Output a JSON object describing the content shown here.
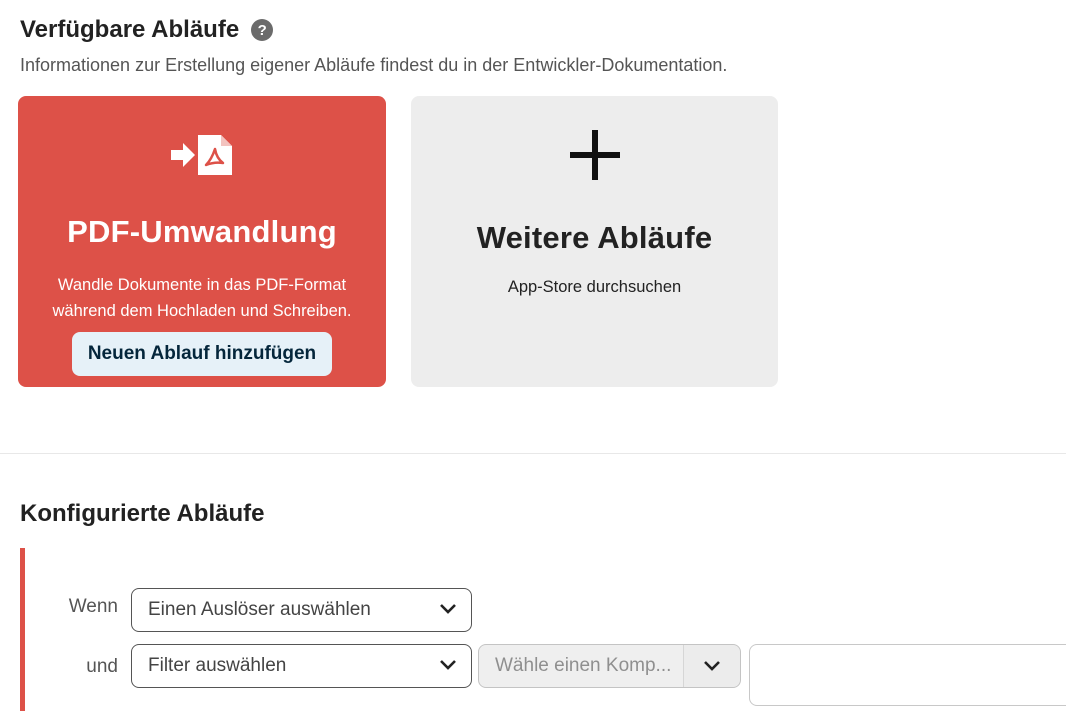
{
  "available": {
    "title": "Verfügbare Abläufe",
    "help_icon": "?",
    "description": "Informationen zur Erstellung eigener Abläufe findest du in der Entwickler-Dokumentation."
  },
  "cards": {
    "pdf": {
      "icon": "pdf-convert-icon",
      "title": "PDF-Umwandlung",
      "desc_line1": "Wandle Dokumente in das PDF-Format",
      "desc_line2": "während dem Hochladen und Schreiben.",
      "button": "Neuen Ablauf hinzufügen",
      "color": "#dd5148"
    },
    "more": {
      "icon": "plus-icon",
      "title": "Weitere Abläufe",
      "desc": "App-Store durchsuchen"
    }
  },
  "configured": {
    "title": "Konfigurierte Abläufe",
    "rows": {
      "when_label": "Wenn",
      "trigger_select": "Einen Auslöser auswählen",
      "and_label": "und",
      "filter_select": "Filter auswählen",
      "comparator_placeholder": "Wähle einen Komp..."
    }
  }
}
